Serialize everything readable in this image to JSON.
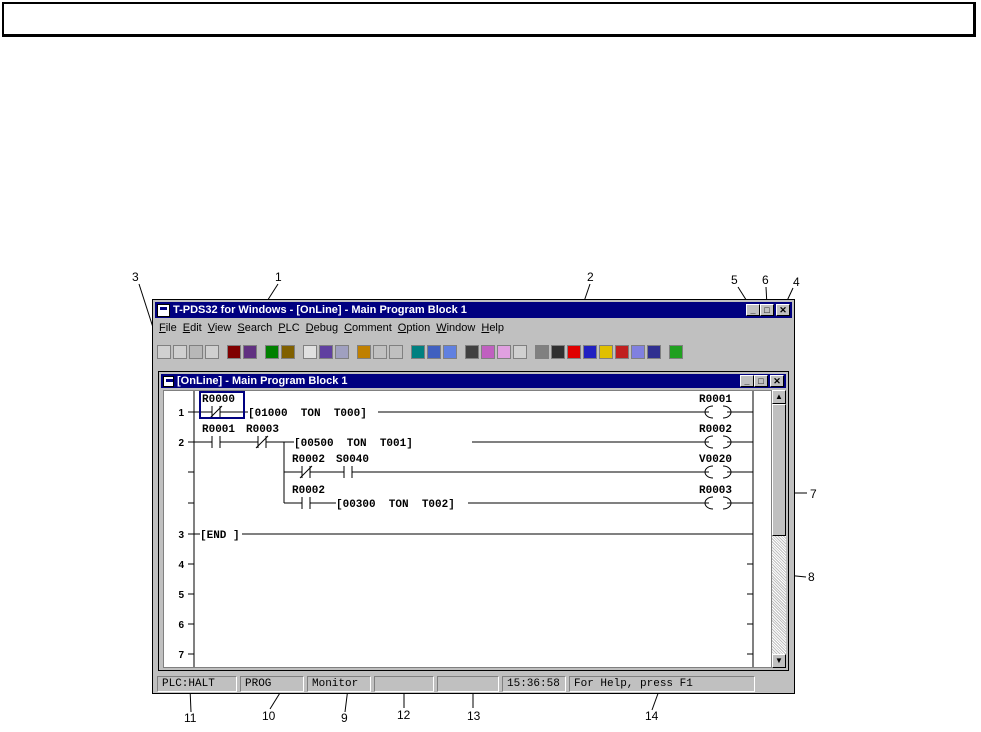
{
  "app": {
    "title": "T-PDS32 for Windows - [OnLine] - Main Program Block 1",
    "menu": [
      "File",
      "Edit",
      "View",
      "Search",
      "PLC",
      "Debug",
      "Comment",
      "Option",
      "Window",
      "Help"
    ]
  },
  "child": {
    "title": "[OnLine] - Main Program Block 1"
  },
  "ladder": {
    "rung_numbers": [
      "1",
      "2",
      "3",
      "4",
      "5",
      "6",
      "7"
    ],
    "contacts": {
      "r0000": "R0000",
      "r0001a": "R0001",
      "r0003": "R0003",
      "r0002a": "R0002",
      "s0040": "S0040",
      "r0002b": "R0002"
    },
    "instructions": {
      "ton0": "[01000  TON  T000]",
      "ton1": "[00500  TON  T001]",
      "ton2": "[00300  TON  T002]",
      "end": "[END ]"
    },
    "coils": {
      "c1": "R0001",
      "c2": "R0002",
      "c3": "V0020",
      "c4": "R0003"
    }
  },
  "status": {
    "plc": "PLC:HALT",
    "mode": "PROG",
    "monitor": "Monitor",
    "p12": "",
    "p13": "",
    "time": "15:36:58",
    "help": "For Help, press F1"
  },
  "callouts": [
    "1",
    "2",
    "3",
    "4",
    "5",
    "6",
    "7",
    "8",
    "9",
    "10",
    "11",
    "12",
    "13",
    "14"
  ]
}
